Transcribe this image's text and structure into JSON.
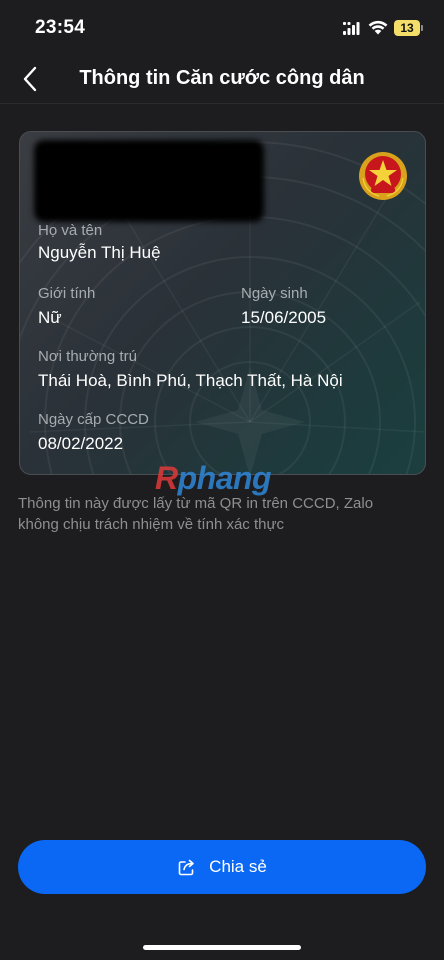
{
  "status_bar": {
    "time": "23:54",
    "battery": "13"
  },
  "header": {
    "title": "Thông tin Căn cước công dân",
    "back_icon": "chevron-left-icon"
  },
  "card": {
    "emblem_icon": "vietnam-national-emblem-icon",
    "name_label": "Họ và tên",
    "name_value": "Nguyễn Thị Huệ",
    "gender_label": "Giới tính",
    "gender_value": "Nữ",
    "dob_label": "Ngày sinh",
    "dob_value": "15/06/2005",
    "residence_label": "Nơi thường trú",
    "residence_value": "Thái Hoà, Bình Phú, Thạch Thất, Hà Nội",
    "issue_label": "Ngày cấp CCCD",
    "issue_value": "08/02/2022"
  },
  "note": "Thông tin này được lấy từ mã QR in trên CCCD, Zalo không chịu trách nhiệm về tính xác thực",
  "watermark": {
    "first": "R",
    "rest": "phang"
  },
  "share_button": {
    "label": "Chia sẻ",
    "icon": "share-icon"
  },
  "colors": {
    "background": "#1d1d1f",
    "accent": "#0a68f4",
    "label": "#a7acb2",
    "note": "#8e8e93"
  }
}
